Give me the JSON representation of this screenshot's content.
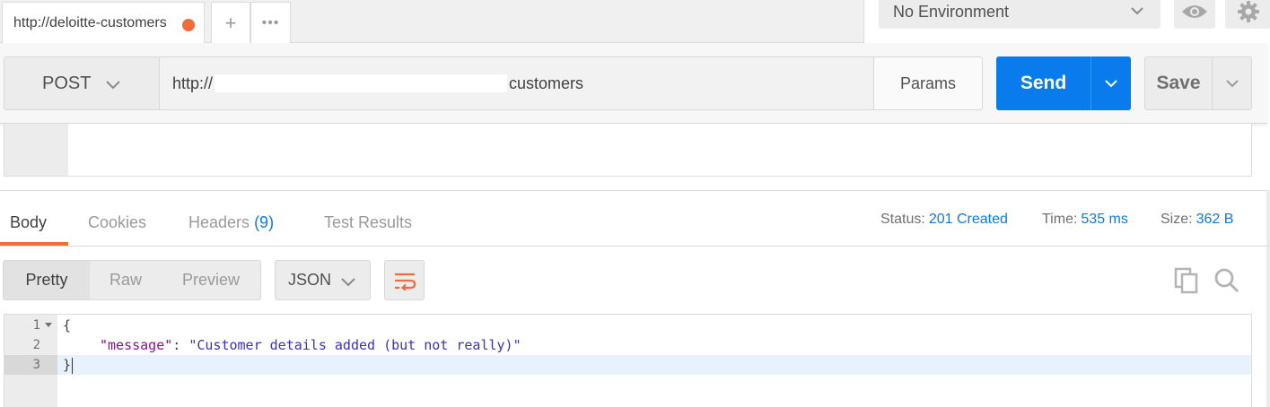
{
  "tabs": {
    "active_tab_label": "http://deloitte-customers",
    "new_tab_symbol": "+",
    "more_symbol": "•••"
  },
  "environment": {
    "selected": "No Environment"
  },
  "request": {
    "method": "POST",
    "url_prefix": "http://",
    "url_suffix": "customers",
    "params_label": "Params",
    "send_label": "Send",
    "save_label": "Save"
  },
  "response": {
    "tabs": {
      "body": "Body",
      "cookies": "Cookies",
      "headers": "Headers",
      "headers_count": "(9)",
      "test_results": "Test Results"
    },
    "meta": {
      "status_label": "Status:",
      "status_value": "201 Created",
      "time_label": "Time:",
      "time_value": "535 ms",
      "size_label": "Size:",
      "size_value": "362 B"
    },
    "view_modes": {
      "pretty": "Pretty",
      "raw": "Raw",
      "preview": "Preview"
    },
    "format": "JSON",
    "code": {
      "line_numbers": [
        "1",
        "2",
        "3"
      ],
      "open_brace": "{",
      "key": "\"message\"",
      "colon": ": ",
      "value": "\"Customer details added (but not really)\"",
      "close_brace": "}"
    }
  },
  "colors": {
    "accent_orange": "#f26b3a",
    "send_blue": "#097bed",
    "link_blue": "#097bed"
  }
}
